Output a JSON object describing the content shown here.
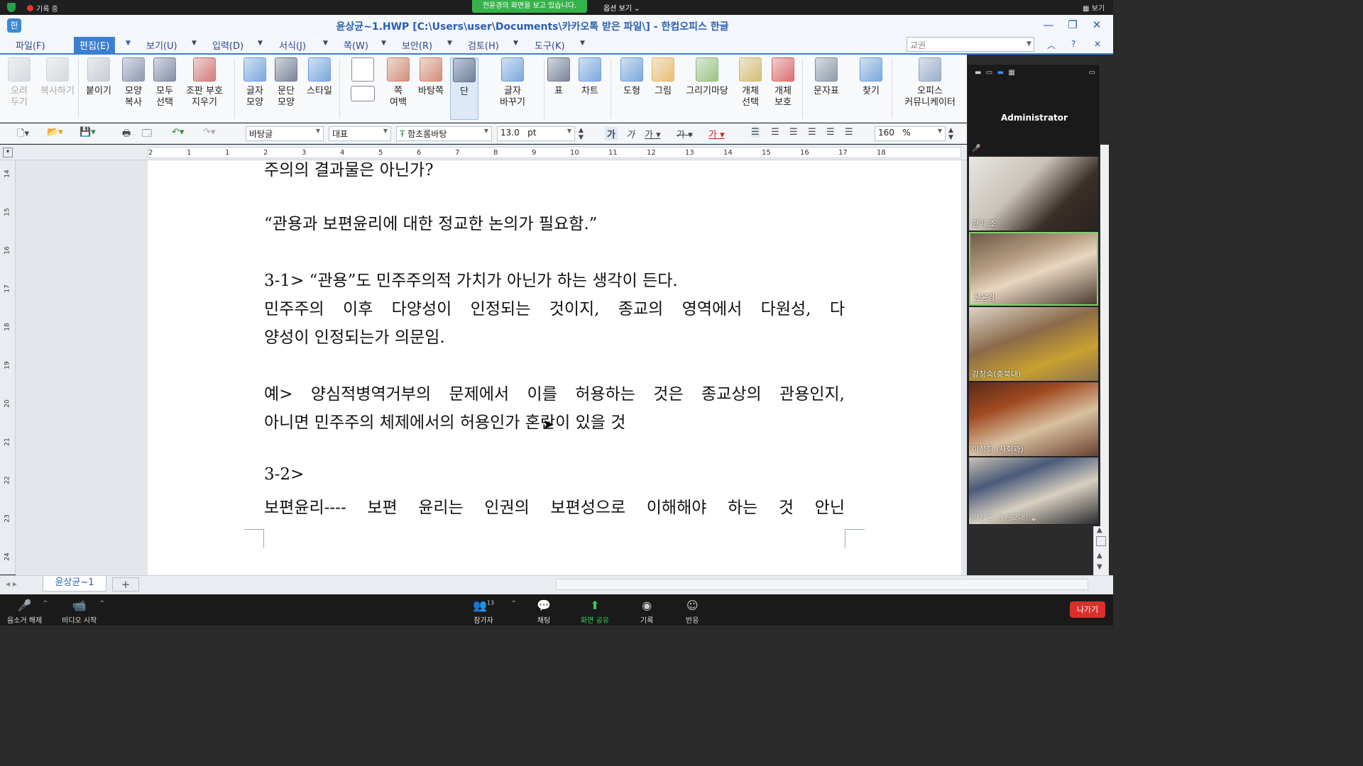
{
  "zoom_top": {
    "recording": "기록 중",
    "banner": "전윤경의 화면을 보고 있습니다.",
    "view_options": "옵션 보기",
    "view": "보기"
  },
  "window": {
    "title": "윤상균~1.HWP [C:\\Users\\user\\Documents\\카카오톡 받은 파일\\] - 한컴오피스 한글"
  },
  "menu": {
    "items": [
      "파일(F)",
      "편집(E)",
      "보기(U)",
      "입력(D)",
      "서식(J)",
      "쪽(W)",
      "보안(R)",
      "검토(H)",
      "도구(K)"
    ],
    "active": "편집(E)",
    "search_placeholder": "교권"
  },
  "ribbon": {
    "buttons": [
      {
        "label": "오려\n두기",
        "icon": "scissors-icon"
      },
      {
        "label": "복사하기",
        "icon": "copy-icon"
      },
      {
        "label": "붙이기",
        "icon": "paste-icon"
      },
      {
        "label": "모양\n복사",
        "icon": "format-painter-icon"
      },
      {
        "label": "모두\n선택",
        "icon": "select-all-icon"
      },
      {
        "label": "조판 부호\n지우기",
        "icon": "clear-marks-icon"
      },
      {
        "label": "글자\n모양",
        "icon": "char-shape-icon"
      },
      {
        "label": "문단\n모양",
        "icon": "para-shape-icon"
      },
      {
        "label": "스타일",
        "icon": "style-icon"
      },
      {
        "label": "쪽\n여백",
        "icon": "page-margin-icon"
      },
      {
        "label": "바탕쪽",
        "icon": "master-page-icon"
      },
      {
        "label": "단",
        "icon": "columns-icon"
      },
      {
        "label": "글자\n바꾸기",
        "icon": "replace-char-icon"
      },
      {
        "label": "표",
        "icon": "table-icon"
      },
      {
        "label": "차트",
        "icon": "chart-icon"
      },
      {
        "label": "도형",
        "icon": "shape-icon"
      },
      {
        "label": "그림",
        "icon": "picture-icon"
      },
      {
        "label": "그리기마당",
        "icon": "clipart-icon"
      },
      {
        "label": "개체\n선택",
        "icon": "object-select-icon"
      },
      {
        "label": "개체\n보호",
        "icon": "object-protect-icon"
      },
      {
        "label": "문자표",
        "icon": "symbol-icon"
      },
      {
        "label": "찾기",
        "icon": "find-icon"
      },
      {
        "label": "오피스\n커뮤니케이터",
        "icon": "communicator-icon"
      }
    ]
  },
  "format": {
    "style": "바탕글",
    "lang": "대표",
    "font": "함초롬바탕",
    "size": "13.0",
    "unit": "pt",
    "zoom": "160",
    "zoom_unit": "%"
  },
  "ruler_h": [
    "2",
    "1",
    "1",
    "2",
    "3",
    "4",
    "5",
    "6",
    "7",
    "8",
    "9",
    "10",
    "11",
    "12",
    "13",
    "14",
    "15",
    "16",
    "17",
    "18"
  ],
  "ruler_v": [
    "14",
    "15",
    "16",
    "17",
    "18",
    "19",
    "20",
    "21",
    "22",
    "23",
    "24"
  ],
  "document": {
    "lines": [
      "주의의 결과물은 아닌가?",
      "“관용과 보편윤리에 대한 정교한 논의가 필요함.”",
      "3-1> “관용”도 민주주의적 가치가 아닌가 하는 생각이 든다.",
      "민주주의 이후 다양성이 인정되는 것이지, 종교의 영역에서 다원성, 다",
      "양성이 인정되는가 의문임.",
      "예> 양심적병역거부의 문제에서 이를 허용하는 것은 종교상의 관용인지,",
      "아니면 민주주의 체제에서의 허용인가 혼란이 있을 것",
      "3-2>",
      "보편윤리---- 보편 윤리는 인권의 보편성으로 이해해야 하는 것 안닌"
    ]
  },
  "tabs": {
    "doc_tab": "윤상균~1",
    "add": "+"
  },
  "gallery": {
    "self": "Administrator",
    "participants": [
      "현기 조",
      "전윤경",
      "강창숙(충북대)",
      "이정희 (사회과)",
      "박상준(경인교대)"
    ]
  },
  "zoom_bottom": {
    "mute": "음소거 해제",
    "video": "비디오 시작",
    "participants": "참가자",
    "participants_count": "13",
    "chat": "채팅",
    "share": "화면 공유",
    "record": "기록",
    "reactions": "반응",
    "leave": "나가기"
  }
}
